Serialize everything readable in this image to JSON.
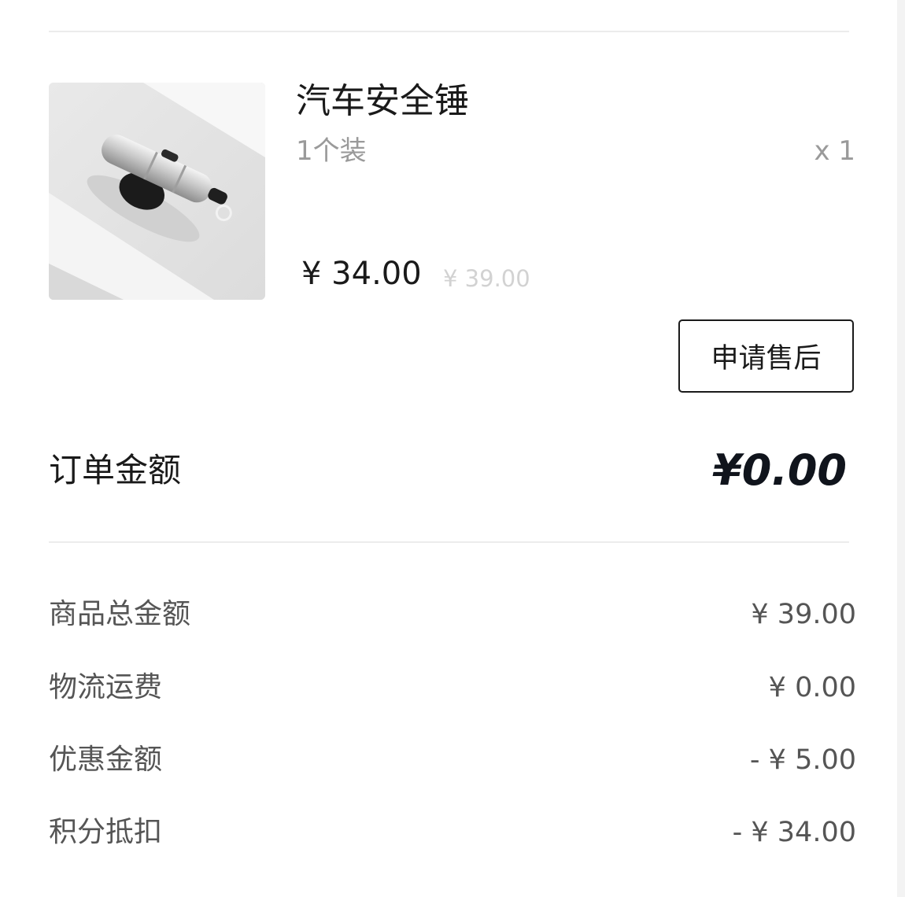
{
  "product": {
    "name": "汽车安全锤",
    "spec": "1个装",
    "quantity": "x 1",
    "price": "¥ 34.00",
    "original_price": "¥ 39.00",
    "image_icon": "car-safety-hammer-photo"
  },
  "actions": {
    "after_sale_label": "申请售后"
  },
  "order": {
    "amount_label": "订单金额",
    "amount_value": "¥0.00"
  },
  "breakdown": [
    {
      "label": "商品总金额",
      "value": "¥ 39.00"
    },
    {
      "label": "物流运费",
      "value": "¥ 0.00"
    },
    {
      "label": "优惠金额",
      "value": "- ¥ 5.00"
    },
    {
      "label": "积分抵扣",
      "value": "- ¥ 34.00"
    }
  ],
  "colors": {
    "text_primary": "#1a1a1a",
    "text_secondary": "#555555",
    "text_muted": "#9a9a9a",
    "divider": "#ececec"
  }
}
